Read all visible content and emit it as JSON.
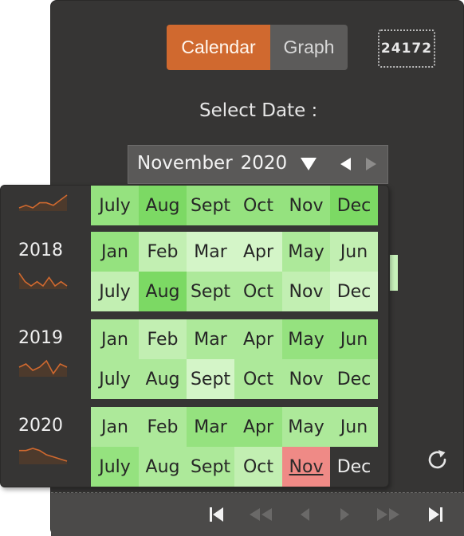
{
  "mode_toggle": {
    "calendar_label": "Calendar",
    "graph_label": "Graph",
    "active": "Calendar"
  },
  "count_badge": "24172",
  "select_date_label": "Select Date :",
  "month_picker": {
    "month": "November",
    "year": "2020"
  },
  "colors": {
    "accent": "#d0692f",
    "panel": "#363534",
    "selected_month": "#ef8a86",
    "empty_month": "#363534",
    "heat_scale": [
      "#d4f5c8",
      "#c2efb2",
      "#ade99a",
      "#95e27f",
      "#7cd964"
    ]
  },
  "calendar": {
    "rows": [
      {
        "year": "",
        "show_sparkline": true,
        "sparkline": [
          3,
          4,
          3,
          5,
          5,
          4,
          6,
          8
        ],
        "months": [
          {
            "label": "July",
            "level": 3
          },
          {
            "label": "Aug",
            "level": 4
          },
          {
            "label": "Sept",
            "level": 3
          },
          {
            "label": "Oct",
            "level": 3
          },
          {
            "label": "Nov",
            "level": 3
          },
          {
            "label": "Dec",
            "level": 4
          }
        ]
      },
      {
        "year": "2018",
        "show_sparkline": true,
        "sparkline": [
          6,
          4,
          3,
          4,
          3,
          5,
          3,
          4,
          3
        ],
        "months": [
          {
            "label": "Jan",
            "level": 3
          },
          {
            "label": "Feb",
            "level": 1
          },
          {
            "label": "Mar",
            "level": 0
          },
          {
            "label": "Apr",
            "level": 0
          },
          {
            "label": "May",
            "level": 2
          },
          {
            "label": "Jun",
            "level": 1
          }
        ]
      },
      {
        "year": "",
        "show_sparkline": false,
        "sparkline": [],
        "months": [
          {
            "label": "July",
            "level": 1
          },
          {
            "label": "Aug",
            "level": 4
          },
          {
            "label": "Sept",
            "level": 2
          },
          {
            "label": "Oct",
            "level": 2
          },
          {
            "label": "Nov",
            "level": 1
          },
          {
            "label": "Dec",
            "level": 0
          }
        ]
      },
      {
        "year": "2019",
        "show_sparkline": true,
        "sparkline": [
          4,
          5,
          3,
          4,
          6,
          2,
          5,
          4
        ],
        "months": [
          {
            "label": "Jan",
            "level": 2
          },
          {
            "label": "Feb",
            "level": 1
          },
          {
            "label": "Mar",
            "level": 2
          },
          {
            "label": "Apr",
            "level": 2
          },
          {
            "label": "May",
            "level": 3
          },
          {
            "label": "Jun",
            "level": 3
          }
        ]
      },
      {
        "year": "",
        "show_sparkline": false,
        "sparkline": [],
        "months": [
          {
            "label": "July",
            "level": 2
          },
          {
            "label": "Aug",
            "level": 2
          },
          {
            "label": "Sept",
            "level": 0
          },
          {
            "label": "Oct",
            "level": 2
          },
          {
            "label": "Nov",
            "level": 2
          },
          {
            "label": "Dec",
            "level": 2
          }
        ]
      },
      {
        "year": "2020",
        "show_sparkline": true,
        "sparkline": [
          6,
          6,
          7,
          6,
          4,
          3,
          2,
          1
        ],
        "months": [
          {
            "label": "Jan",
            "level": 2
          },
          {
            "label": "Feb",
            "level": 2
          },
          {
            "label": "Mar",
            "level": 3
          },
          {
            "label": "Apr",
            "level": 3
          },
          {
            "label": "May",
            "level": 2
          },
          {
            "label": "Jun",
            "level": 2
          }
        ]
      },
      {
        "year": "",
        "show_sparkline": false,
        "sparkline": [],
        "months": [
          {
            "label": "July",
            "level": 3
          },
          {
            "label": "Aug",
            "level": 2
          },
          {
            "label": "Sept",
            "level": 2
          },
          {
            "label": "Oct",
            "level": 1
          },
          {
            "label": "Nov",
            "level": "selected"
          },
          {
            "label": "Dec",
            "level": "empty"
          }
        ]
      }
    ]
  },
  "footer_nav": [
    "first-icon",
    "rewind-icon",
    "step-back-icon",
    "step-forward-icon",
    "fast-forward-icon",
    "last-icon"
  ],
  "icons": {
    "dropdown": "triangle-down-icon",
    "prev": "triangle-left-icon",
    "next": "triangle-right-icon",
    "refresh": "refresh-icon"
  }
}
